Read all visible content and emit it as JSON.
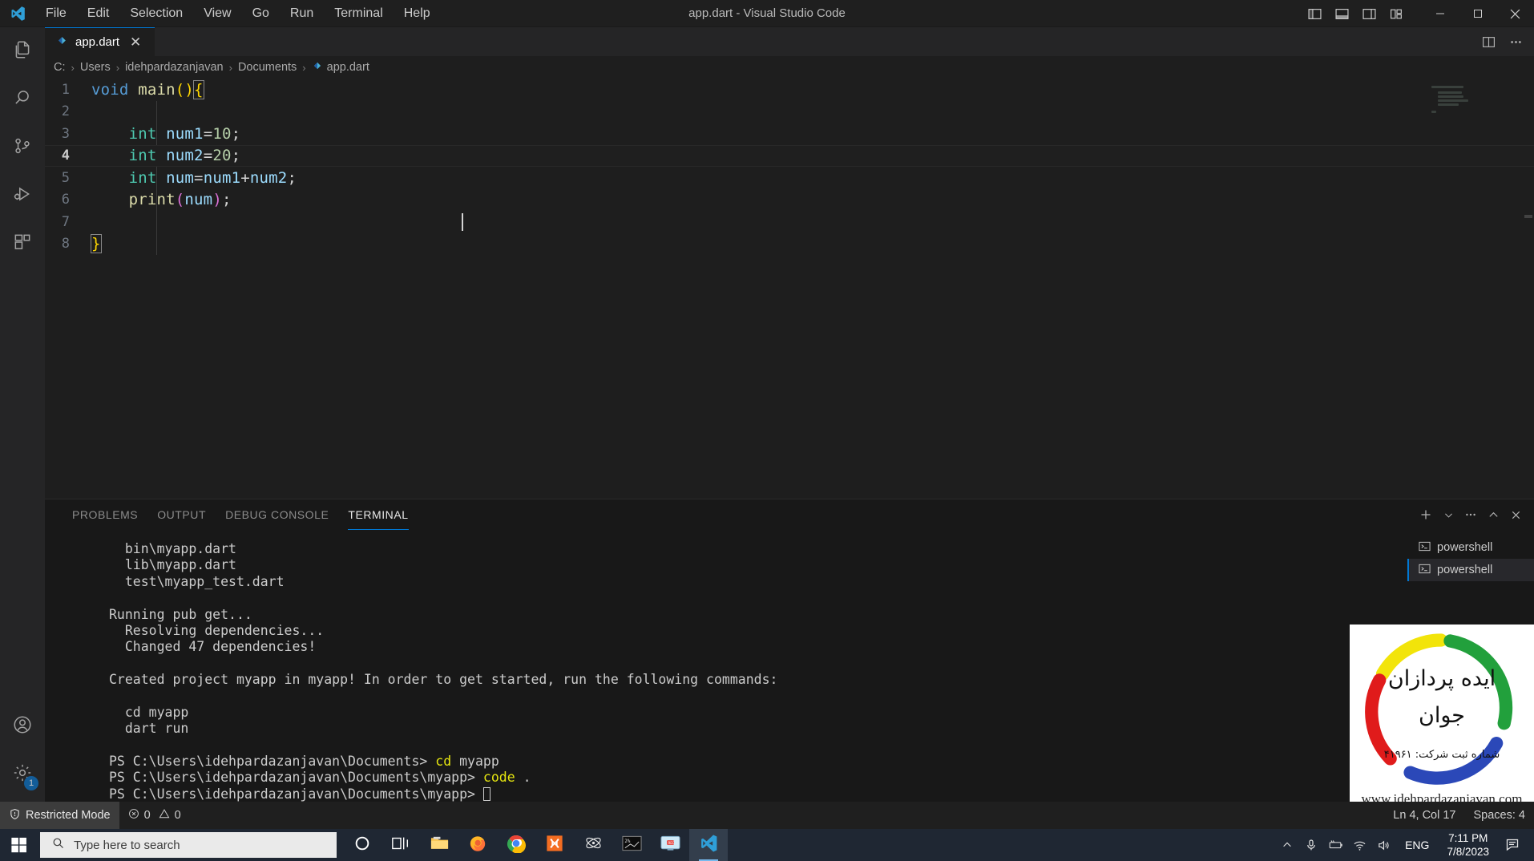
{
  "window": {
    "title": "app.dart - Visual Studio Code",
    "menu": [
      "File",
      "Edit",
      "Selection",
      "View",
      "Go",
      "Run",
      "Terminal",
      "Help"
    ],
    "layout_buttons": [
      {
        "name": "toggle-primary-sidebar",
        "label": "Toggle Primary Side Bar"
      },
      {
        "name": "toggle-panel",
        "label": "Toggle Panel"
      },
      {
        "name": "toggle-secondary-sidebar",
        "label": "Toggle Secondary Side Bar"
      },
      {
        "name": "customize-layout",
        "label": "Customize Layout"
      }
    ],
    "controls": {
      "minimize": "—",
      "maximize": "□",
      "close": "✕"
    }
  },
  "activitybar": {
    "items": [
      {
        "name": "explorer",
        "icon": "files-icon"
      },
      {
        "name": "search",
        "icon": "search-icon"
      },
      {
        "name": "source-control",
        "icon": "source-control-icon"
      },
      {
        "name": "run-and-debug",
        "icon": "run-debug-icon"
      },
      {
        "name": "extensions",
        "icon": "extensions-icon"
      }
    ],
    "bottom": [
      {
        "name": "accounts",
        "icon": "account-icon",
        "badge": ""
      },
      {
        "name": "manage",
        "icon": "gear-icon",
        "badge": "1"
      }
    ]
  },
  "editor": {
    "tab": {
      "label": "app.dart",
      "icon": "dart-file-icon",
      "close": "✕"
    },
    "tab_actions": [
      {
        "name": "split-editor",
        "icon": "split-editor-icon"
      },
      {
        "name": "more-actions",
        "icon": "ellipsis-icon"
      }
    ],
    "breadcrumb": [
      "C:",
      "Users",
      "idehpardazanjavan",
      "Documents",
      "app.dart"
    ],
    "breadcrumb_separator": "›",
    "current_line": 4,
    "lines": [
      {
        "n": "1",
        "tokens": [
          {
            "t": "void",
            "c": "kw"
          },
          {
            "t": " ",
            "c": "punc"
          },
          {
            "t": "main",
            "c": "fn"
          },
          {
            "t": "()",
            "c": "paren-y"
          },
          {
            "t": "{",
            "c": "brace-hl"
          }
        ]
      },
      {
        "n": "2",
        "tokens": []
      },
      {
        "n": "3",
        "tokens": [
          {
            "t": "    ",
            "c": "punc"
          },
          {
            "t": "int",
            "c": "typ"
          },
          {
            "t": " ",
            "c": "punc"
          },
          {
            "t": "num1",
            "c": "var"
          },
          {
            "t": "=",
            "c": "punc"
          },
          {
            "t": "10",
            "c": "num"
          },
          {
            "t": ";",
            "c": "punc"
          }
        ]
      },
      {
        "n": "4",
        "tokens": [
          {
            "t": "    ",
            "c": "punc"
          },
          {
            "t": "int",
            "c": "typ"
          },
          {
            "t": " ",
            "c": "punc"
          },
          {
            "t": "num2",
            "c": "var"
          },
          {
            "t": "=",
            "c": "punc"
          },
          {
            "t": "20",
            "c": "num"
          },
          {
            "t": ";",
            "c": "punc"
          }
        ]
      },
      {
        "n": "5",
        "tokens": [
          {
            "t": "    ",
            "c": "punc"
          },
          {
            "t": "int",
            "c": "typ"
          },
          {
            "t": " ",
            "c": "punc"
          },
          {
            "t": "num",
            "c": "var"
          },
          {
            "t": "=",
            "c": "punc"
          },
          {
            "t": "num1",
            "c": "var"
          },
          {
            "t": "+",
            "c": "punc"
          },
          {
            "t": "num2",
            "c": "var"
          },
          {
            "t": ";",
            "c": "punc"
          }
        ]
      },
      {
        "n": "6",
        "tokens": [
          {
            "t": "    ",
            "c": "punc"
          },
          {
            "t": "print",
            "c": "fn"
          },
          {
            "t": "(",
            "c": "paren-p"
          },
          {
            "t": "num",
            "c": "var"
          },
          {
            "t": ")",
            "c": "paren-p"
          },
          {
            "t": ";",
            "c": "punc"
          }
        ]
      },
      {
        "n": "7",
        "tokens": []
      },
      {
        "n": "8",
        "tokens": [
          {
            "t": "}",
            "c": "brace-hl"
          }
        ]
      }
    ]
  },
  "panel": {
    "tabs": [
      {
        "label": "PROBLEMS",
        "active": false
      },
      {
        "label": "OUTPUT",
        "active": false
      },
      {
        "label": "DEBUG CONSOLE",
        "active": false
      },
      {
        "label": "TERMINAL",
        "active": true
      }
    ],
    "actions": [
      {
        "name": "new-terminal",
        "icon": "plus-icon"
      },
      {
        "name": "terminal-profile-dropdown",
        "icon": "chevron-down-icon"
      },
      {
        "name": "panel-views-and-more",
        "icon": "ellipsis-icon"
      },
      {
        "name": "maximize-panel",
        "icon": "chevron-up-icon"
      },
      {
        "name": "close-panel",
        "icon": "close-icon"
      }
    ],
    "terminal_lines": [
      [
        {
          "t": "  bin\\myapp.dart",
          "c": "t-white"
        }
      ],
      [
        {
          "t": "  lib\\myapp.dart",
          "c": "t-white"
        }
      ],
      [
        {
          "t": "  test\\myapp_test.dart",
          "c": "t-white"
        }
      ],
      [],
      [
        {
          "t": "Running pub get...",
          "c": "t-white"
        }
      ],
      [
        {
          "t": "  Resolving dependencies...",
          "c": "t-white"
        }
      ],
      [
        {
          "t": "  Changed 47 dependencies!",
          "c": "t-white"
        }
      ],
      [],
      [
        {
          "t": "Created project myapp in myapp! In order to get started, run the following commands:",
          "c": "t-white"
        }
      ],
      [],
      [
        {
          "t": "  cd myapp",
          "c": "t-white"
        }
      ],
      [
        {
          "t": "  dart run",
          "c": "t-white"
        }
      ],
      [],
      [
        {
          "t": "PS C:\\Users\\idehpardazanjavan\\Documents> ",
          "c": "t-white"
        },
        {
          "t": "cd",
          "c": "t-yellow"
        },
        {
          "t": " myapp",
          "c": "t-white"
        }
      ],
      [
        {
          "t": "PS C:\\Users\\idehpardazanjavan\\Documents\\myapp> ",
          "c": "t-white"
        },
        {
          "t": "code",
          "c": "t-yellow"
        },
        {
          "t": " .",
          "c": "t-white"
        }
      ],
      [
        {
          "t": "PS C:\\Users\\idehpardazanjavan\\Documents\\myapp> ",
          "c": "t-white"
        }
      ]
    ],
    "terminal_instances": [
      {
        "label": "powershell",
        "active": false
      },
      {
        "label": "powershell",
        "active": true
      }
    ]
  },
  "statusbar": {
    "restricted_mode": "Restricted Mode",
    "errors": "0",
    "warnings": "0",
    "cursor_position": "Ln 4, Col 17",
    "indentation": "Spaces: 4"
  },
  "taskbar": {
    "search_placeholder": "Type here to search",
    "apps": [
      {
        "name": "cortana",
        "icon": "cortana-icon"
      },
      {
        "name": "task-view",
        "icon": "task-view-icon"
      },
      {
        "name": "file-explorer",
        "icon": "folder-icon"
      },
      {
        "name": "firefox",
        "icon": "firefox-icon"
      },
      {
        "name": "chrome",
        "icon": "chrome-icon"
      },
      {
        "name": "xampp",
        "icon": "xampp-icon"
      },
      {
        "name": "atom",
        "icon": "atom-icon"
      },
      {
        "name": "command-prompt",
        "icon": "terminal-icon"
      },
      {
        "name": "screen-recorder",
        "icon": "monitor-icon"
      },
      {
        "name": "visual-studio-code",
        "icon": "vscode-icon"
      }
    ],
    "tray": {
      "language": "ENG",
      "time": "7:11 PM",
      "date": "7/8/2023"
    }
  },
  "watermark": {
    "line1": "ایده پردازان",
    "line2": "جوان",
    "registration": "شماره ثبت شرکت: ۴۱۹۶۱",
    "url": "www.idehpardazanjavan.com"
  },
  "colors": {
    "accent": "#0078d4",
    "editor_bg": "#1e1e1e",
    "panel_bg": "#181818",
    "taskbar_bg": "#1f2733"
  }
}
